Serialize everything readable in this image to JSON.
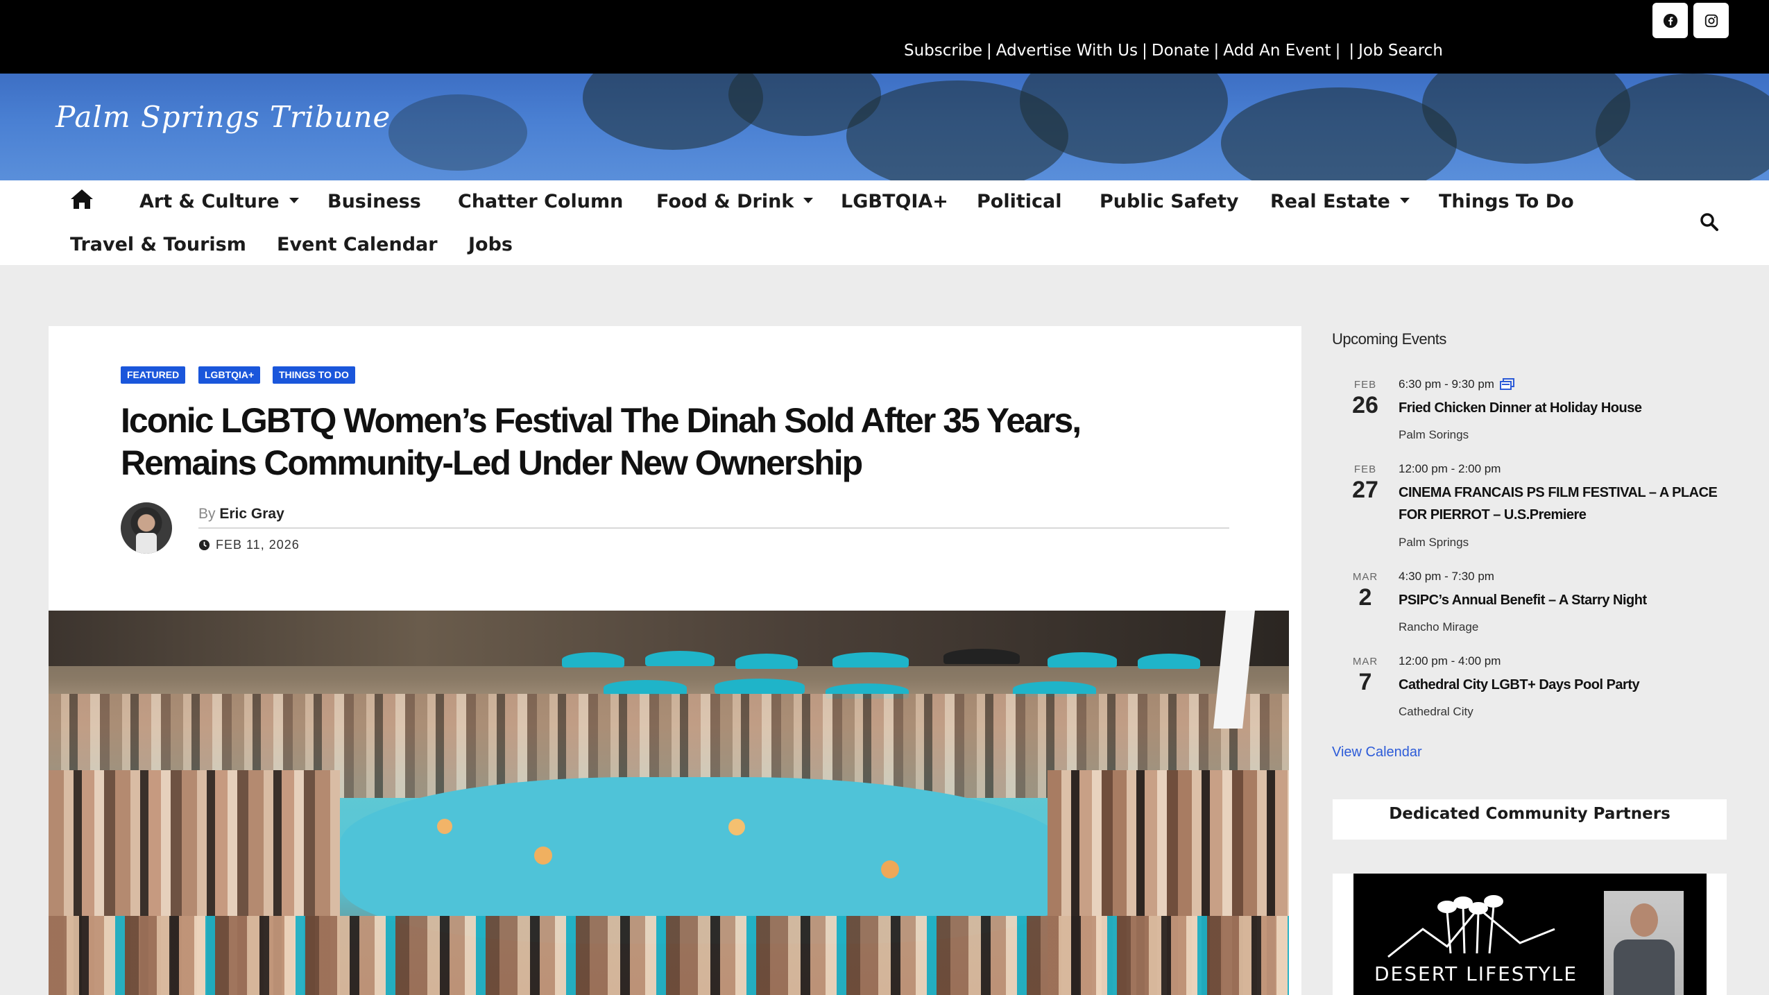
{
  "topbar": {
    "links": [
      "Subscribe",
      "Advertise With Us",
      "Donate",
      "Add An Event",
      "",
      "Job Search"
    ],
    "social": [
      "facebook-icon",
      "instagram-icon"
    ]
  },
  "site": {
    "logo": "Palm Springs Tribune"
  },
  "nav": {
    "items": [
      {
        "label": "Art & Culture",
        "dropdown": true
      },
      {
        "label": "Business",
        "dropdown": false
      },
      {
        "label": "Chatter Column",
        "dropdown": false
      },
      {
        "label": "Food & Drink",
        "dropdown": true
      },
      {
        "label": "LGBTQIA+",
        "dropdown": false
      },
      {
        "label": "Political",
        "dropdown": false
      },
      {
        "label": "Public Safety",
        "dropdown": false
      },
      {
        "label": "Real Estate",
        "dropdown": true
      },
      {
        "label": "Things To Do",
        "dropdown": false
      },
      {
        "label": "Travel & Tourism",
        "dropdown": false
      },
      {
        "label": "Event Calendar",
        "dropdown": false
      },
      {
        "label": "Jobs",
        "dropdown": false
      }
    ]
  },
  "article": {
    "badges": [
      "FEATURED",
      "LGBTQIA+",
      "THINGS TO DO"
    ],
    "headline": "Iconic LGBTQ Women’s Festival The Dinah Sold After 35 Years, Remains Community-Led Under New Ownership",
    "by_label": "By",
    "author": "Eric Gray",
    "date": "FEB 11, 2026"
  },
  "sidebar": {
    "title": "Upcoming Events",
    "events": [
      {
        "month": "FEB",
        "day": "26",
        "time": "6:30 pm - 9:30 pm",
        "recurring": true,
        "name": "Fried Chicken Dinner at Holiday House",
        "venue": "Palm Sorings"
      },
      {
        "month": "FEB",
        "day": "27",
        "time": "12:00 pm - 2:00 pm",
        "recurring": false,
        "name": "CINEMA FRANCAIS PS FILM FESTIVAL – A PLACE FOR PIERROT – U.S.Premiere",
        "venue": "Palm Springs"
      },
      {
        "month": "MAR",
        "day": "2",
        "time": "4:30 pm - 7:30 pm",
        "recurring": false,
        "name": "PSIPC’s Annual Benefit – A Starry Night",
        "venue": "Rancho Mirage"
      },
      {
        "month": "MAR",
        "day": "7",
        "time": "12:00 pm - 4:00 pm",
        "recurring": false,
        "name": "Cathedral City LGBT+ Days Pool Party",
        "venue": "Cathedral City"
      }
    ],
    "view_calendar": "View Calendar",
    "partners_title": "Dedicated Community Partners",
    "ad_text": "DESERT LIFESTYLE"
  },
  "colors": {
    "accent": "#1a56db",
    "link": "#2c5bd8",
    "topbar": "#000000"
  }
}
